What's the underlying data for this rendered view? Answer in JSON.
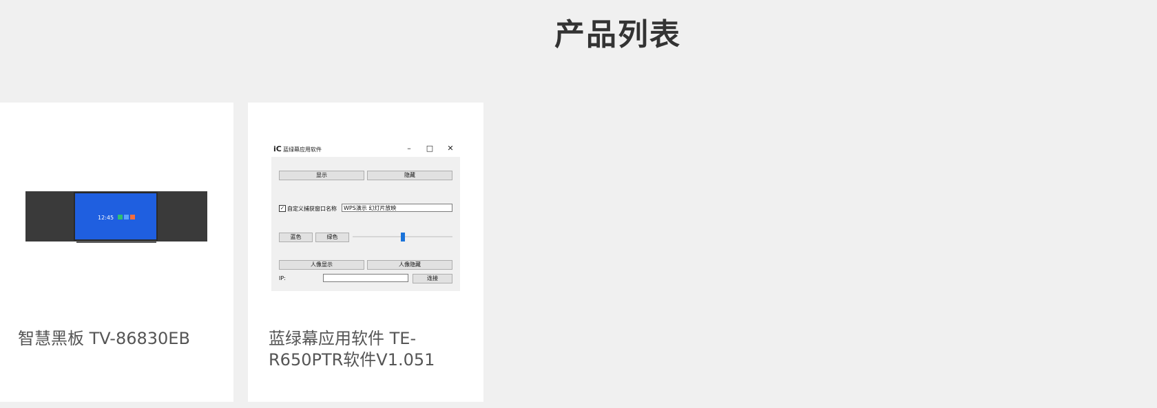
{
  "page": {
    "title": "产品列表"
  },
  "products": [
    {
      "name": "智慧黑板 TV-86830EB",
      "image": {
        "type": "smart-blackboard",
        "screen_time": "12:45"
      }
    },
    {
      "name": "蓝绿幕应用软件 TE-R650PTR软件V1.051",
      "image": {
        "type": "software-window",
        "logo": "iC",
        "window_title": "蓝绿幕应用软件",
        "show_label": "显示",
        "hide_label": "隐藏",
        "custom_window_label": "自定义捕获窗口名称",
        "custom_window_value": "WPS演示 幻灯片放映",
        "custom_window_checked": true,
        "blue_label": "蓝色",
        "green_label": "绿色",
        "slider_value": 0.5,
        "portrait_show_label": "人像显示",
        "portrait_hide_label": "人像隐藏",
        "ip_label": "IP:",
        "ip_value": "",
        "connect_label": "连接"
      }
    }
  ],
  "colors": {
    "background": "#f0f0f0",
    "card": "#ffffff",
    "screen_blue": "#1f5fe0",
    "slider_blue": "#1a73d9"
  }
}
